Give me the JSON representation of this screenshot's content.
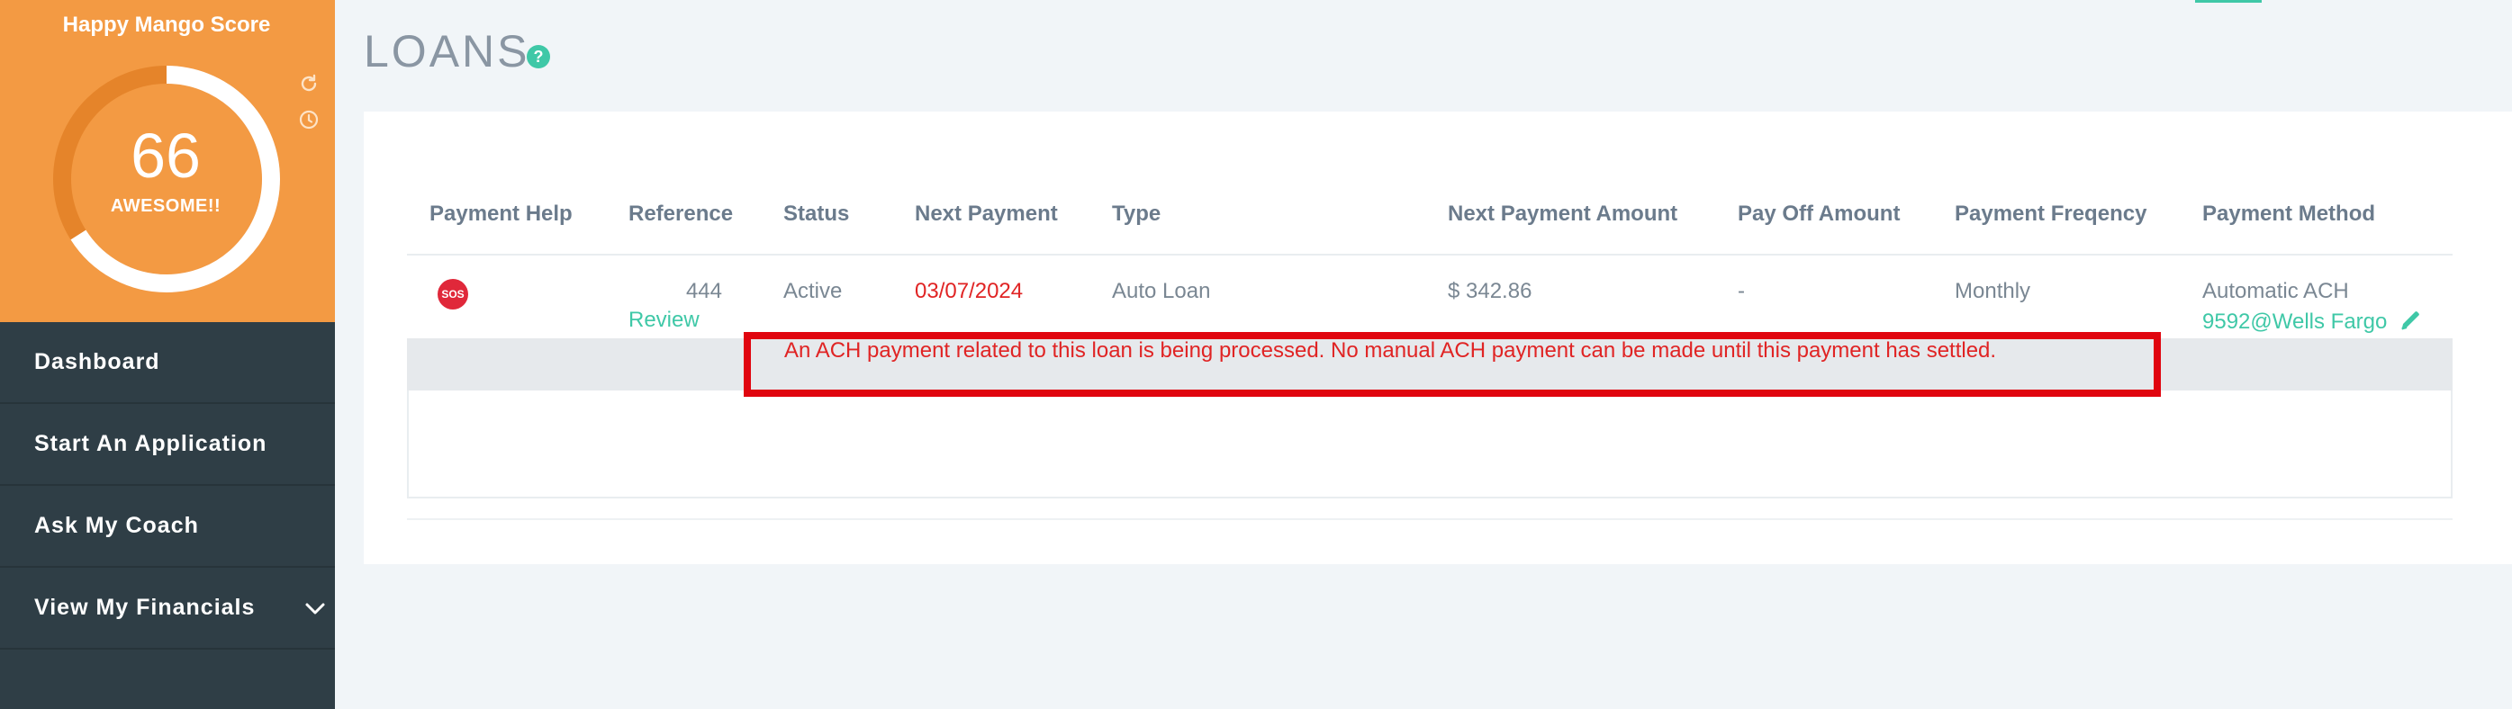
{
  "sidebar": {
    "score": {
      "title": "Happy Mango Score",
      "value": "66",
      "label": "AWESOME!!",
      "gauge_fraction": 0.66,
      "gauge_color": "#ffffff",
      "track_color": "#e5842a"
    },
    "icons": [
      "refresh-icon",
      "clock-icon"
    ],
    "nav": [
      {
        "label": "Dashboard"
      },
      {
        "label": "Start An Application"
      },
      {
        "label": "Ask My Coach"
      },
      {
        "label": "View My Financials",
        "icon": "chevron-down-icon"
      }
    ]
  },
  "page": {
    "title": "LOANS",
    "help_icon": "?"
  },
  "table": {
    "headers": {
      "payment_help": "Payment Help",
      "reference": "Reference",
      "status": "Status",
      "next_payment": "Next Payment",
      "type": "Type",
      "next_payment_amount": "Next Payment Amount",
      "pay_off_amount": "Pay Off Amount",
      "payment_frequency": "Payment Freqency",
      "payment_method": "Payment Method"
    },
    "row": {
      "sos_badge": "SOS",
      "reference": "444",
      "review_link": "Review",
      "status": "Active",
      "next_payment": "03/07/2024",
      "type": "Auto Loan",
      "next_payment_amount": "$ 342.86",
      "pay_off_amount": "-",
      "payment_frequency": "Monthly",
      "payment_method": "Automatic ACH",
      "payment_account": "9592@Wells Fargo",
      "edit_icon": "pencil-icon"
    },
    "notice": "An ACH payment related to this loan is being processed. No manual ACH payment can be made until this payment has settled."
  },
  "colors": {
    "accent": "#3fc8a7",
    "orange": "#f39a43",
    "sidebar": "#2f3e46",
    "alert_red": "#e02424"
  }
}
